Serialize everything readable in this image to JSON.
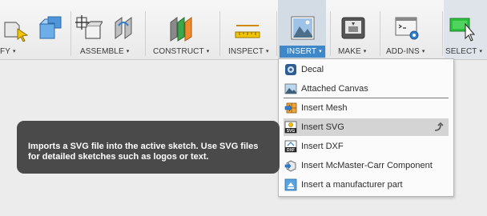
{
  "toolbar": {
    "groups": [
      {
        "label": "FY",
        "caret": "▾"
      },
      {
        "label": "ASSEMBLE",
        "caret": "▾"
      },
      {
        "label": "CONSTRUCT",
        "caret": "▾"
      },
      {
        "label": "INSPECT",
        "caret": "▾"
      },
      {
        "label": "INSERT",
        "caret": "▾"
      },
      {
        "label": "MAKE",
        "caret": "▾"
      },
      {
        "label": "ADD-INS",
        "caret": "▾"
      },
      {
        "label": "SELECT",
        "caret": "▾"
      }
    ]
  },
  "insert_menu": {
    "items": [
      {
        "label": "Decal",
        "icon": "decal-icon"
      },
      {
        "label": "Attached Canvas",
        "icon": "attached-canvas-icon"
      },
      {
        "label": "Insert Mesh",
        "icon": "insert-mesh-icon"
      },
      {
        "label": "Insert SVG",
        "icon": "insert-svg-icon",
        "highlighted": true
      },
      {
        "label": "Insert DXF",
        "icon": "insert-dxf-icon"
      },
      {
        "label": "Insert McMaster-Carr Component",
        "icon": "mcmaster-carr-icon"
      },
      {
        "label": "Insert a manufacturer part",
        "icon": "manufacturer-part-icon"
      }
    ]
  },
  "tooltip": {
    "text": "Imports a SVG file into the active sketch. Use SVG files for detailed sketches such as logos or text."
  },
  "colors": {
    "toolbar_bg": "#ececec",
    "insert_active": "#3e87c9",
    "menu_highlight": "#d4d4d4",
    "tooltip_bg": "#4a4a4a",
    "select_icon": "#2fbf3f"
  }
}
